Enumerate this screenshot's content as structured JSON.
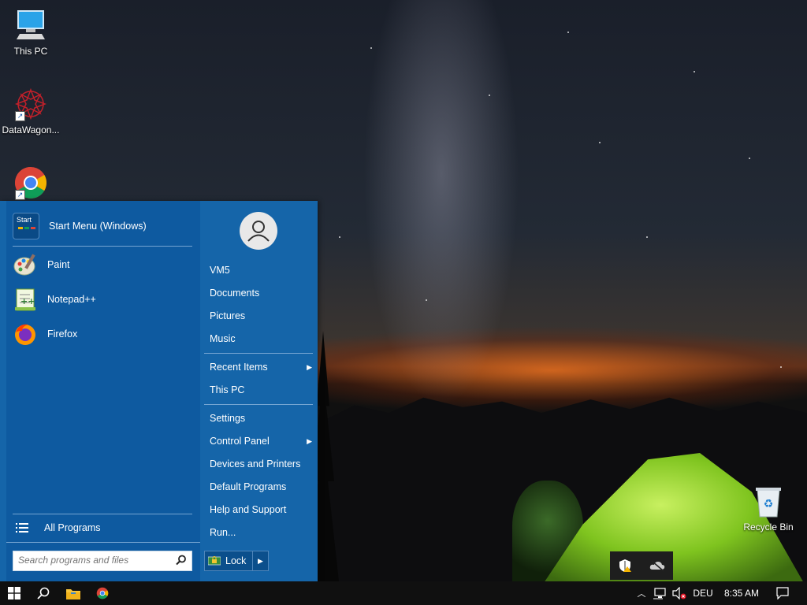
{
  "desktop": {
    "icons": [
      {
        "label": "This PC",
        "icon": "computer-icon"
      },
      {
        "label": "DataWagon...",
        "icon": "datawagon-icon"
      },
      {
        "label": "",
        "icon": "chrome-icon"
      },
      {
        "label": "Recycle Bin",
        "icon": "recycle-bin-icon"
      }
    ]
  },
  "start_menu": {
    "pinned": [
      {
        "label": "Start Menu (Windows)",
        "icon": "start-menu-icon"
      },
      {
        "label": "Paint",
        "icon": "paint-icon"
      },
      {
        "label": "Notepad++",
        "icon": "notepad-plus-plus-icon"
      },
      {
        "label": "Firefox",
        "icon": "firefox-icon"
      }
    ],
    "all_programs": "All Programs",
    "search_placeholder": "Search programs and files",
    "right_items": {
      "user": "VM5",
      "documents": "Documents",
      "pictures": "Pictures",
      "music": "Music",
      "recent_items": "Recent Items",
      "this_pc": "This PC",
      "settings": "Settings",
      "control_panel": "Control Panel",
      "devices_printers": "Devices and Printers",
      "default_programs": "Default Programs",
      "help_support": "Help and Support",
      "run": "Run..."
    },
    "lock_label": "Lock",
    "start_icon_text": "Start"
  },
  "taskbar": {
    "language": "DEU",
    "time": "8:35 AM"
  },
  "colors": {
    "start_menu_bg": "#1565a9",
    "left_pane_bg": "#0e5aa0",
    "taskbar_bg": "#101010"
  }
}
